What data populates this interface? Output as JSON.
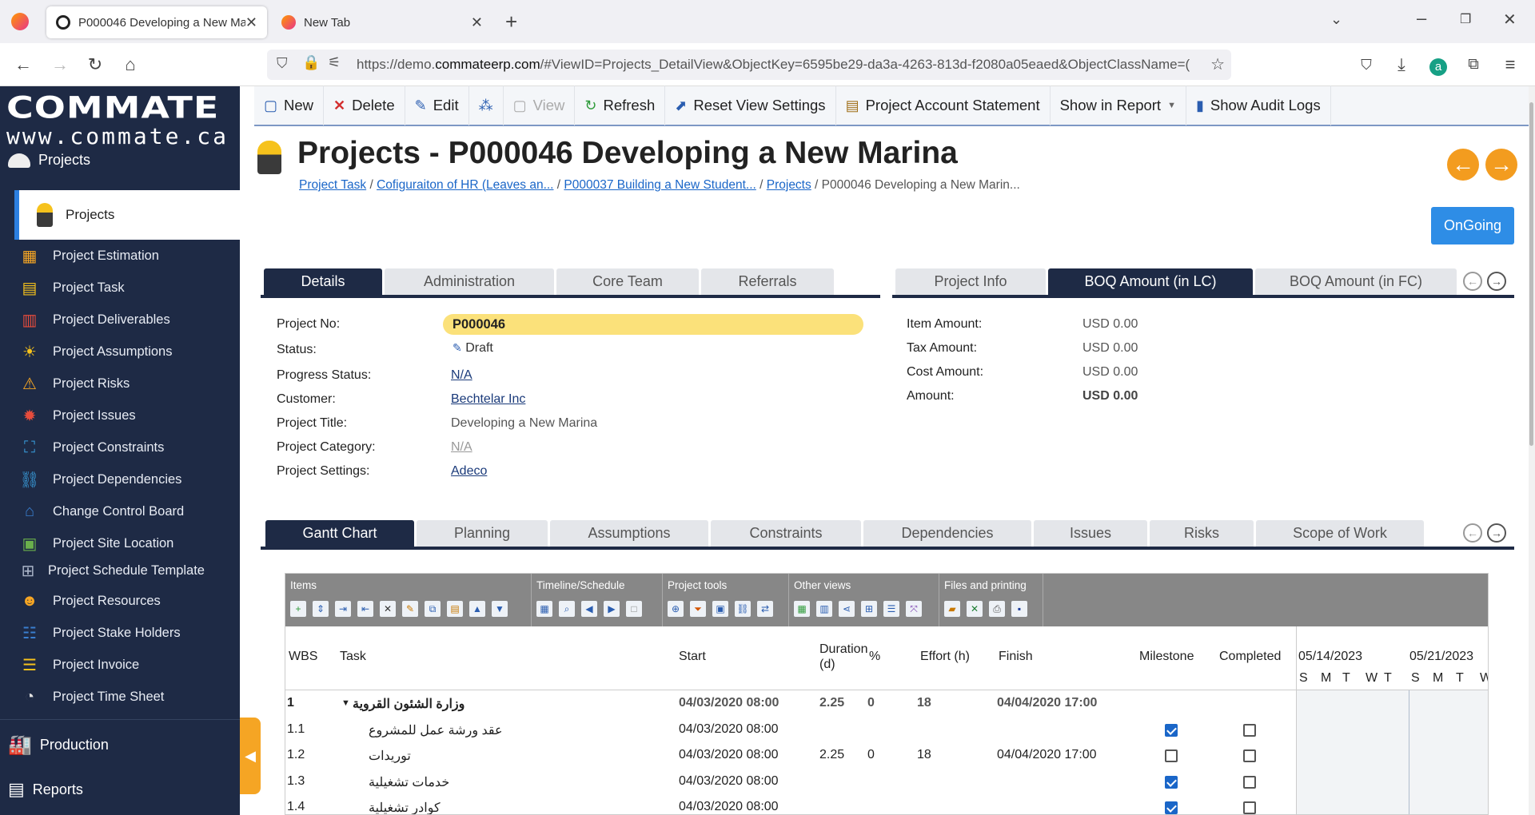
{
  "browser": {
    "tabs": [
      {
        "title": "P000046 Developing a New Ma",
        "active": true
      },
      {
        "title": "New Tab",
        "active": false
      }
    ],
    "url_prefix": "https://demo.",
    "url_domain": "commateerp.com",
    "url_rest": "/#ViewID=Projects_DetailView&ObjectKey=6595be29-da3a-4263-813d-f2080a05eaed&ObjectClassName=("
  },
  "sidebar": {
    "logo": "COMMATE",
    "logo_url": "www.commate.ca",
    "group_projects": "Projects",
    "active_item": "Projects",
    "items": [
      "Project Estimation",
      "Project Task",
      "Project Deliverables",
      "Project Assumptions",
      "Project Risks",
      "Project Issues",
      "Project Constraints",
      "Project Dependencies",
      "Change Control Board",
      "Project Site Location",
      "Project Schedule Template",
      "Project Resources",
      "Project Stake Holders",
      "Project Invoice",
      "Project Time Sheet"
    ],
    "group_production": "Production",
    "group_reports": "Reports"
  },
  "toolbar": {
    "new": "New",
    "delete": "Delete",
    "edit": "Edit",
    "view": "View",
    "refresh": "Refresh",
    "reset_view": "Reset View Settings",
    "account_statement": "Project Account Statement",
    "show_in_report": "Show in Report",
    "audit_logs": "Show Audit Logs"
  },
  "header": {
    "title": "Projects - P000046 Developing a New Marina",
    "breadcrumbs": [
      "Project Task",
      "Cofiguraiton of HR (Leaves an...",
      "P000037 Building a New Student...",
      "Projects"
    ],
    "breadcrumb_current": "P000046 Developing a New Marin...",
    "status_button": "OnGoing"
  },
  "left_tabs": [
    "Details",
    "Administration",
    "Core Team",
    "Referrals"
  ],
  "right_tabs": [
    "Project Info",
    "BOQ Amount (in LC)",
    "BOQ Amount (in FC)"
  ],
  "details": {
    "project_no_label": "Project No:",
    "project_no": "P000046",
    "status_label": "Status:",
    "status": "Draft",
    "progress_label": "Progress Status:",
    "progress": "N/A",
    "customer_label": "Customer:",
    "customer": "Bechtelar Inc",
    "title_label": "Project Title:",
    "title": "Developing a New Marina",
    "category_label": "Project Category:",
    "category": "N/A",
    "settings_label": "Project Settings:",
    "settings": "Adeco"
  },
  "boq": {
    "item_label": "Item Amount:",
    "item": "USD 0.00",
    "tax_label": "Tax Amount:",
    "tax": "USD 0.00",
    "cost_label": "Cost Amount:",
    "cost": "USD 0.00",
    "amount_label": "Amount:",
    "amount": "USD 0.00"
  },
  "bottom_tabs": [
    "Gantt Chart",
    "Planning",
    "Assumptions",
    "Constraints",
    "Dependencies",
    "Issues",
    "Risks",
    "Scope of Work"
  ],
  "gantt": {
    "sections": [
      "Items",
      "Timeline/Schedule",
      "Project tools",
      "Other views",
      "Files and printing"
    ],
    "columns": {
      "wbs": "WBS",
      "task": "Task",
      "start": "Start",
      "duration": "Duration",
      "duration_unit": "(d)",
      "percent": "%",
      "effort": "Effort (h)",
      "finish": "Finish",
      "milestone": "Milestone",
      "completed": "Completed"
    },
    "weeks": [
      "05/14/2023",
      "05/21/2023"
    ],
    "days": [
      "S",
      "M",
      "T",
      "W",
      "T",
      "S",
      "M",
      "T",
      "W"
    ],
    "rows": [
      {
        "wbs": "1",
        "task": "وزارة الشئون القروية",
        "start": "04/03/2020 08:00",
        "duration": "2.25",
        "pct": "0",
        "effort": "18",
        "finish": "04/04/2020 17:00",
        "milestone": null,
        "completed": null,
        "bold": true
      },
      {
        "wbs": "1.1",
        "task": "عقد ورشة عمل للمشروع",
        "start": "04/03/2020 08:00",
        "duration": "",
        "pct": "",
        "effort": "",
        "finish": "",
        "milestone": true,
        "completed": false,
        "bold": false
      },
      {
        "wbs": "1.2",
        "task": "توريدات",
        "start": "04/03/2020 08:00",
        "duration": "2.25",
        "pct": "0",
        "effort": "18",
        "finish": "04/04/2020 17:00",
        "milestone": false,
        "completed": false,
        "bold": false
      },
      {
        "wbs": "1.3",
        "task": "خدمات تشغيلية",
        "start": "04/03/2020 08:00",
        "duration": "",
        "pct": "",
        "effort": "",
        "finish": "",
        "milestone": true,
        "completed": false,
        "bold": false
      },
      {
        "wbs": "1.4",
        "task": "كوادر تشغيلية",
        "start": "04/03/2020 08:00",
        "duration": "",
        "pct": "",
        "effort": "",
        "finish": "",
        "milestone": true,
        "completed": false,
        "bold": false
      }
    ]
  }
}
